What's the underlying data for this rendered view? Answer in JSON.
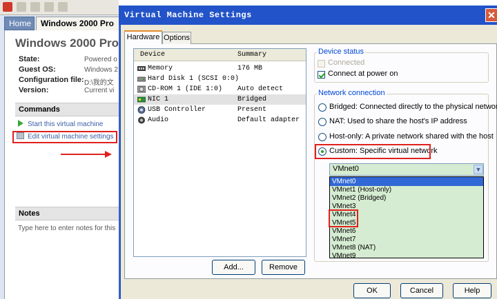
{
  "console": {
    "tabs": [
      {
        "label": "Home"
      },
      {
        "label": "Windows 2000 Pro"
      }
    ],
    "vm_title": "Windows 2000 Prof",
    "info": [
      {
        "key": "State:",
        "value": "Powered o"
      },
      {
        "key": "Guest OS:",
        "value": "Windows 2"
      },
      {
        "key": "Configuration file:",
        "value": "D:\\我的文"
      },
      {
        "key": "Version:",
        "value": "Current vi"
      }
    ],
    "commands_header": "Commands",
    "start_command": "Start this virtual machine",
    "edit_command": "Edit virtual machine settings",
    "notes_header": "Notes",
    "notes_placeholder": "Type here to enter notes for this"
  },
  "dialog": {
    "title": "Virtual Machine Settings",
    "tabs": [
      {
        "label": "Hardware"
      },
      {
        "label": "Options"
      }
    ],
    "device_list": {
      "columns": [
        "Device",
        "Summary"
      ],
      "rows": [
        {
          "device": "Memory",
          "summary": "176 MB",
          "icon": "memory-icon"
        },
        {
          "device": "Hard Disk 1 (SCSI 0:0)",
          "summary": "",
          "icon": "hard-disk-icon"
        },
        {
          "device": "CD-ROM 1 (IDE 1:0)",
          "summary": "Auto detect",
          "icon": "cdrom-icon"
        },
        {
          "device": "NIC 1",
          "summary": "Bridged",
          "icon": "network-card-icon",
          "selected": true
        },
        {
          "device": "USB Controller",
          "summary": "Present",
          "icon": "usb-icon"
        },
        {
          "device": "Audio",
          "summary": "Default adapter",
          "icon": "audio-icon"
        }
      ]
    },
    "add_button": "Add...",
    "remove_button": "Remove",
    "device_status": {
      "title": "Device status",
      "connected": "Connected",
      "connect_at_power_on": "Connect at power on"
    },
    "network_connection": {
      "title": "Network connection",
      "options": [
        {
          "label": "Bridged: Connected directly to the physical network"
        },
        {
          "label": "NAT: Used to share the host's IP address"
        },
        {
          "label": "Host-only: A private network shared with the host"
        },
        {
          "label": "Custom: Specific virtual network",
          "selected": true
        }
      ]
    },
    "vmnet_select_value": "VMnet0",
    "vmnet_options": [
      "VMnet0",
      "VMnet1 (Host-only)",
      "VMnet2 (Bridged)",
      "VMnet3",
      "VMnet4",
      "VMnet5",
      "VMnet6",
      "VMnet7",
      "VMnet8 (NAT)",
      "VMnet9"
    ],
    "ok_button": "OK",
    "cancel_button": "Cancel",
    "help_button": "Help",
    "close_glyph": "✕"
  },
  "colors": {
    "titlebar": "#2253c8",
    "highlight_red": "#e0201c",
    "dropdown_green": "#d6ecd2",
    "selection_blue": "#3168d5"
  }
}
